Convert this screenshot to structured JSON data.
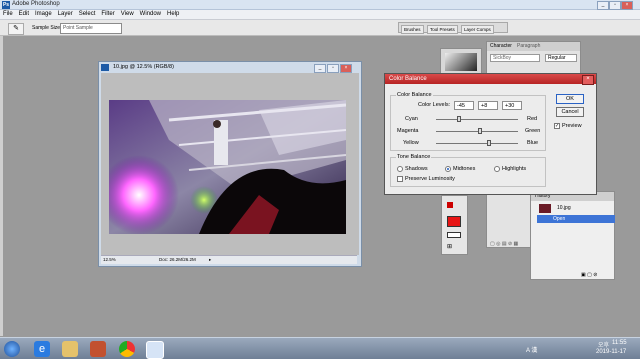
{
  "app": {
    "title": "Adobe Photoshop",
    "icon_text": "Ps"
  },
  "menu": [
    "File",
    "Edit",
    "Image",
    "Layer",
    "Select",
    "Filter",
    "View",
    "Window",
    "Help"
  ],
  "options": {
    "sample_size_label": "Sample Size:",
    "sample_size_value": "Point Sample"
  },
  "palette_well_tabs": [
    "Brushes",
    "Tool Presets",
    "Layer Comps"
  ],
  "document": {
    "title": "10.jpg @ 12.5% (RGB/8)",
    "zoom": "12.5%",
    "doc_size": "Doc: 26.2M/26.2M"
  },
  "color_balance": {
    "title": "Color Balance",
    "group_label": "Color Balance",
    "levels_label": "Color Levels:",
    "levels": [
      "-45",
      "+8",
      "+30"
    ],
    "sliders": [
      {
        "left": "Cyan",
        "right": "Red",
        "value": -45
      },
      {
        "left": "Magenta",
        "right": "Green",
        "value": 8
      },
      {
        "left": "Yellow",
        "right": "Blue",
        "value": 30
      }
    ],
    "tone_label": "Tone Balance",
    "tones": [
      "Shadows",
      "Midtones",
      "Highlights"
    ],
    "selected_tone": "Midtones",
    "preserve_label": "Preserve Luminosity",
    "preserve_checked": false,
    "ok_label": "OK",
    "cancel_label": "Cancel",
    "preview_label": "Preview",
    "preview_checked": true
  },
  "character_panel": {
    "tabs": [
      "Character",
      "Paragraph"
    ],
    "font": "SickBoy",
    "style": "Regular"
  },
  "layers_panel": {
    "history_tab": "History",
    "snapshot": "10.jpg",
    "state": "Open"
  },
  "taskbar": {
    "ime": "A 漢",
    "day": "오후",
    "time": "11:55",
    "date": "2019-11-17"
  }
}
